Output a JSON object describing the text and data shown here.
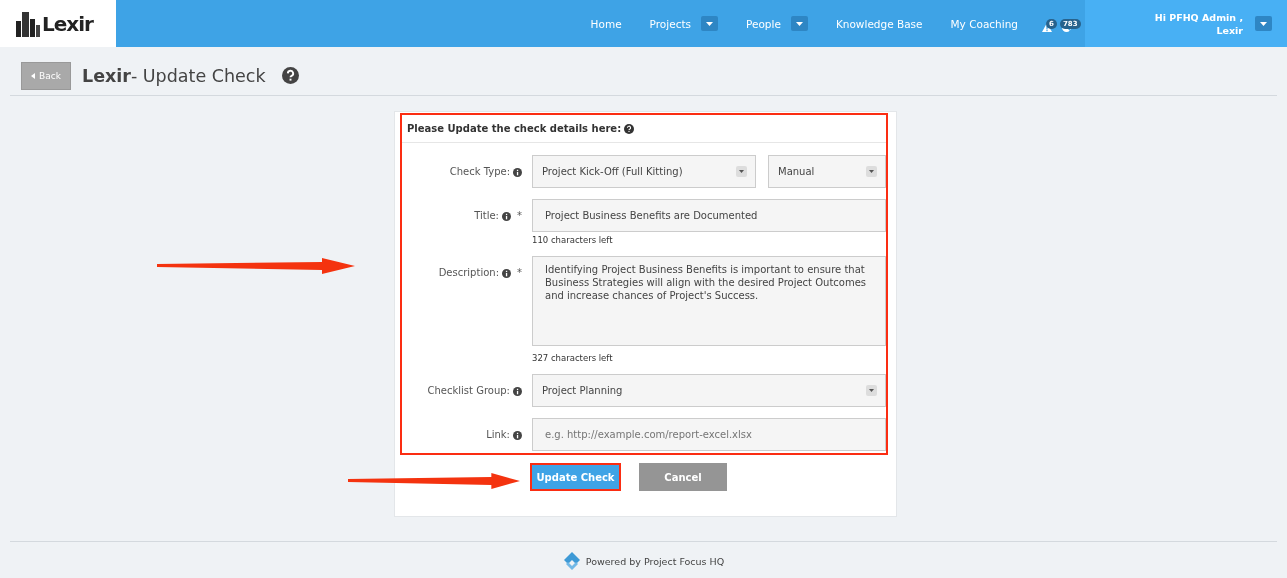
{
  "navbar": {
    "logo": "Lexir",
    "items": [
      {
        "label": "Home",
        "dropdown": false
      },
      {
        "label": "Projects",
        "dropdown": true
      },
      {
        "label": "People",
        "dropdown": true
      },
      {
        "label": "Knowledge Base",
        "dropdown": false
      },
      {
        "label": "My Coaching",
        "dropdown": false
      }
    ],
    "alerts": [
      {
        "kind": "warning",
        "count": "6"
      },
      {
        "kind": "globe",
        "count": "783"
      }
    ],
    "user": [
      "Hi PFHQ Admin ,",
      "Lexir"
    ]
  },
  "page_header": {
    "back": "Back",
    "title": "**Lexir**- Update Check"
  },
  "form": {
    "heading": "Please Update the check details here:",
    "highlighted": true,
    "fields": [
      {
        "kind": "select_pair",
        "label": "Check Type:",
        "values": [
          "Project Kick-Off (Full Kitting)",
          "Manual"
        ]
      },
      {
        "kind": "input",
        "label": "Title:",
        "marker": "*",
        "value": "Project Business Benefits are Documented",
        "hint": "110 characters left"
      },
      {
        "kind": "textarea",
        "label": "Description:",
        "marker": "*",
        "value": "Identifying Project Business Benefits is important to ensure that Business Strategies will align with the desired Project Outcomes and increase chances of Project's Success.",
        "hint": "327 characters left"
      },
      {
        "kind": "select",
        "label": "Checklist Group:",
        "value": "Project Planning"
      },
      {
        "kind": "input",
        "label": "Link:",
        "placeholder": "e.g. http://example.com/report-excel.xlsx"
      }
    ],
    "buttons": [
      {
        "label": "Update Check",
        "kind": "primary",
        "highlighted": true
      },
      {
        "label": "Cancel",
        "kind": "secondary",
        "highlighted": false
      }
    ]
  },
  "footer": "Powered by Project Focus HQ"
}
